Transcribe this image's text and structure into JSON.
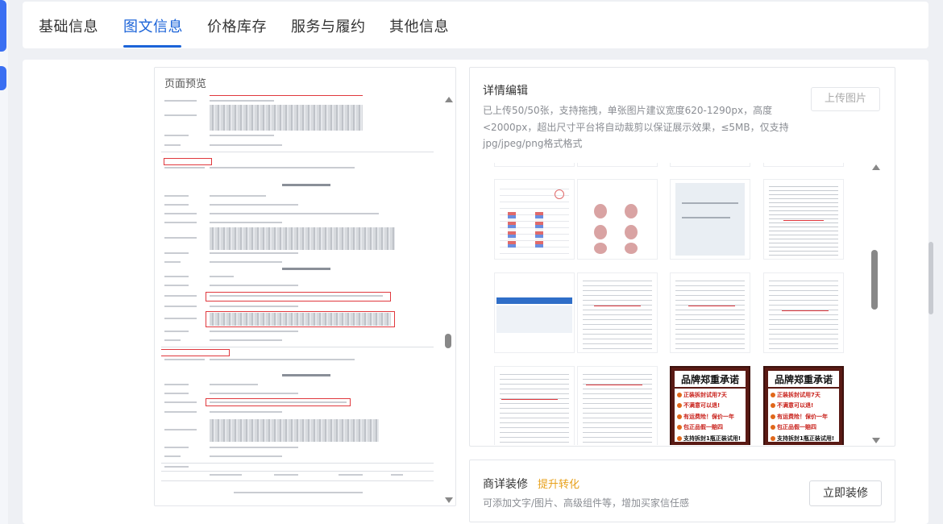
{
  "tabs": [
    {
      "label": "基础信息"
    },
    {
      "label": "图文信息"
    },
    {
      "label": "价格库存"
    },
    {
      "label": "服务与履约"
    },
    {
      "label": "其他信息"
    }
  ],
  "active_tab": "图文信息",
  "preview": {
    "title": "页面预览"
  },
  "editor": {
    "title": "详情编辑",
    "description": "已上传50/50张，支持拖拽，单张图片建议宽度620-1290px，高度<2000px，超出尺寸平台将自动裁剪以保证展示效果，≤5MB，仅支持jpg/jpeg/png格式格式",
    "upload_label": "上传图片",
    "brand_card": {
      "title": "品牌郑重承诺",
      "lines": [
        "正装拆封试用7天",
        "不满意可以退!",
        "有运费险！保价一年",
        "包正品假一赔四",
        "支持拆封1瓶正装试用!"
      ]
    }
  },
  "decoration": {
    "title": "商详装修",
    "badge": "提升转化",
    "description": "可添加文字/图片、高级组件等，增加买家信任感",
    "button_label": "立即装修"
  },
  "colors": {
    "accent": "#1b63d8",
    "badge": "#e8a11c",
    "highlight_box": "#e0393e"
  }
}
